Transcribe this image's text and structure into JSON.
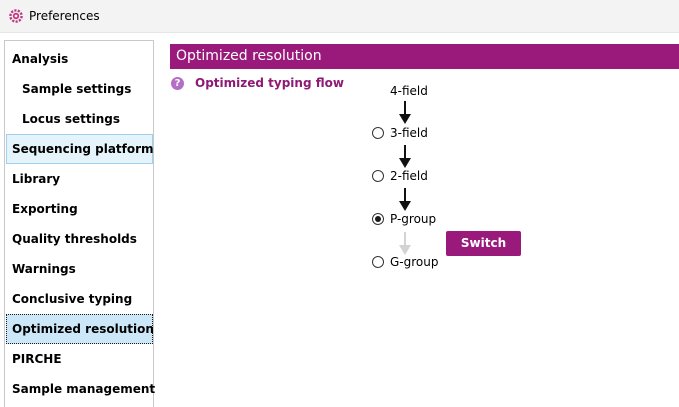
{
  "window": {
    "title": "Preferences",
    "icon": "gear-icon",
    "accent_color": "#9a1a7c"
  },
  "sidebar": {
    "items": [
      {
        "label": "Analysis"
      },
      {
        "label": "Sample settings"
      },
      {
        "label": "Locus settings"
      },
      {
        "label": "Sequencing platform"
      },
      {
        "label": "Library"
      },
      {
        "label": "Exporting"
      },
      {
        "label": "Quality thresholds"
      },
      {
        "label": "Warnings"
      },
      {
        "label": "Conclusive typing"
      },
      {
        "label": "Optimized resolution"
      },
      {
        "label": "PIRCHE"
      },
      {
        "label": "Sample management"
      }
    ],
    "selected": "Optimized resolution"
  },
  "panel": {
    "header": "Optimized resolution",
    "flow_label": "Optimized typing flow",
    "help_icon": "question-icon",
    "help_glyph": "?",
    "fields": [
      {
        "label": "4-field"
      },
      {
        "label": "3-field",
        "checked": false
      },
      {
        "label": "2-field",
        "checked": false
      },
      {
        "label": "P-group",
        "checked": true
      },
      {
        "label": "G-group",
        "checked": false
      }
    ],
    "switch_label": "Switch"
  }
}
